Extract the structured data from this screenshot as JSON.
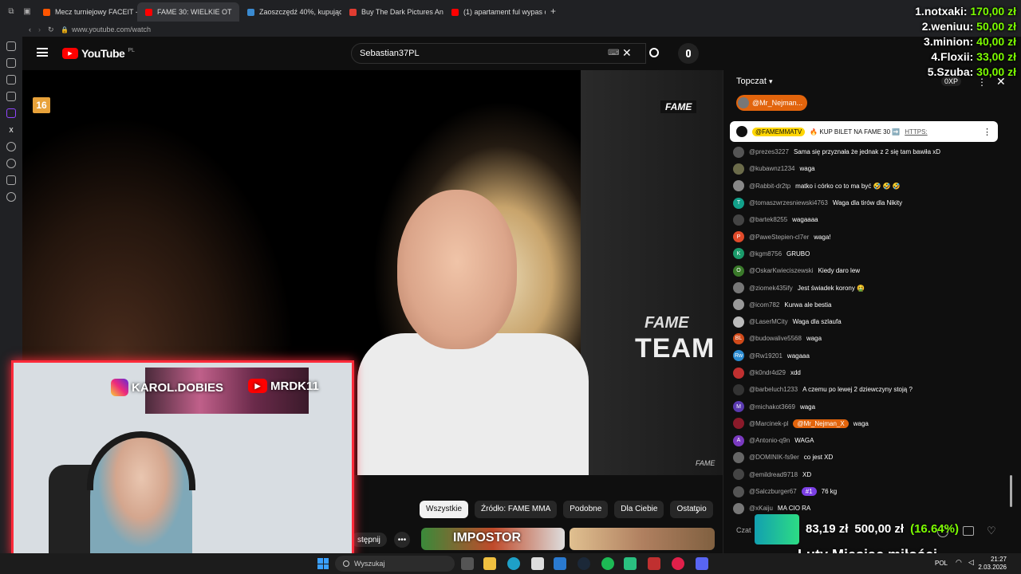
{
  "browser": {
    "tabs": [
      {
        "label": "Mecz turniejowy FACEIT -",
        "color": "#ff5500"
      },
      {
        "label": "FAME 30: WIELKIE OT",
        "color": "#ff0000"
      },
      {
        "label": "Zaoszczędź 40%, kupując",
        "color": "#1b2838"
      },
      {
        "label": "Buy The Dark Pictures An",
        "color": "#e03c31"
      },
      {
        "label": "(1) apartament ful wypas o",
        "color": "#ff0000"
      }
    ],
    "new_tab": "+",
    "url": "www.youtube.com/watch"
  },
  "youtube": {
    "logo_text": "YouTube",
    "logo_region": "PL",
    "search_value": "Sebastian37PL"
  },
  "video": {
    "age_rating": "16",
    "fame_logo": "FAME",
    "team_fame": "FAME",
    "team_text": "TEAM",
    "fame_small": "FAME"
  },
  "chips": [
    "Wszystkie",
    "Źródło: FAME MMA",
    "Podobne",
    "Dla Ciebie",
    "Ostatnio"
  ],
  "share_label": "stępnij",
  "thumb_text": "IMPOSTOR",
  "webcam": {
    "instagram": "KAROL.DOBIES",
    "youtube": "MRDK11"
  },
  "chat": {
    "header": "Topczat",
    "pinned_user": "@Mr_Nejman...",
    "pinned_author": "@FAMEMMATV",
    "pinned_text": "🔥 KUP BILET NA FAME 30 ➡️",
    "pinned_link": "HTTPS:",
    "xp": "0XP",
    "messages": [
      {
        "author": "@prezes3227",
        "text": "Sama się przyznała że jednak z 2 się tam bawiła xD",
        "avatar": "#555",
        "initial": ""
      },
      {
        "author": "@kubawnz1234",
        "text": "waga",
        "avatar": "#6b6b4a",
        "initial": ""
      },
      {
        "author": "@Rabbit-dr2tp",
        "text": "matko i córko co to ma być 🤣 🤣 🤣",
        "avatar": "#888",
        "initial": ""
      },
      {
        "author": "@tomaszwrzesniewski4763",
        "text": "Waga dla tirów dla Nikity",
        "avatar": "#12a08a",
        "initial": "T"
      },
      {
        "author": "@bartek8255",
        "text": "wagaaaa",
        "avatar": "#444",
        "initial": ""
      },
      {
        "author": "@PaweStepien-cl7er",
        "text": "waga!",
        "avatar": "#e04a2a",
        "initial": "P"
      },
      {
        "author": "@kgm8756",
        "text": "GRUBO",
        "avatar": "#1a9a6a",
        "initial": "K"
      },
      {
        "author": "@OskarKwieciszewski",
        "text": "Kiedy daro lew",
        "avatar": "#3a7a2a",
        "initial": "O"
      },
      {
        "author": "@ziomek435ify",
        "text": "Jest świadek korony 🤮",
        "avatar": "#777",
        "initial": ""
      },
      {
        "author": "@icom782",
        "text": "Kurwa ale bestia",
        "avatar": "#999",
        "initial": ""
      },
      {
        "author": "@LaserMCity",
        "text": "Waga dla szlaufa",
        "avatar": "#bbb",
        "initial": ""
      },
      {
        "author": "@budowalive5568",
        "text": "waga",
        "avatar": "#d04a1a",
        "initial": "BL"
      },
      {
        "author": "@Rw19201",
        "text": "wagaaa",
        "avatar": "#2a8ad0",
        "initial": "Rw"
      },
      {
        "author": "@k0ndr4d29",
        "text": "xdd",
        "avatar": "#c03030",
        "initial": ""
      },
      {
        "author": "@barbeluch1233",
        "text": "A czemu po lewej 2 dziewczyny stoją ?",
        "avatar": "#333",
        "initial": ""
      },
      {
        "author": "@michakot3669",
        "text": "waga",
        "avatar": "#5a3ab0",
        "initial": "M"
      },
      {
        "author": "@Marcinek-pl",
        "text": "waga",
        "avatar": "#8a1a2a",
        "initial": "",
        "badge": "@Mr_Nejman_X"
      },
      {
        "author": "@Antonio-q9n",
        "text": "WAGA",
        "avatar": "#7a3ac0",
        "initial": "A"
      },
      {
        "author": "@DOMINIK-fs9er",
        "text": "co jest XD",
        "avatar": "#666",
        "initial": ""
      },
      {
        "author": "@emildread9718",
        "text": "XD",
        "avatar": "#444",
        "initial": ""
      },
      {
        "author": "@Salczburger67",
        "text": "76 kg",
        "avatar": "#555",
        "initial": "",
        "badge": "#1",
        "badge_purple": true
      },
      {
        "author": "@xKaiju",
        "text": "MA CIO RA",
        "avatar": "#777",
        "initial": ""
      }
    ],
    "input_placeholder": "Czat"
  },
  "donors": [
    {
      "name": "1.notxaki:",
      "amount": "170,00 zł"
    },
    {
      "name": "2.weniuu:",
      "amount": "50,00 zł"
    },
    {
      "name": "3.minion:",
      "amount": "40,00 zł"
    },
    {
      "name": "4.Floxii:",
      "amount": "33,00 zł"
    },
    {
      "name": "5.Szuba:",
      "amount": "30,00 zł"
    }
  ],
  "goal": {
    "current": "83,19 zł",
    "target": "500,00 zł",
    "percent_label": "(16.64%)",
    "fraction": 0.1664,
    "title": "Luty Miesiąc miłości"
  },
  "taskbar": {
    "search": "Wyszukaj",
    "time": "21:27",
    "date": "2.03.2026",
    "lang": "POL"
  }
}
